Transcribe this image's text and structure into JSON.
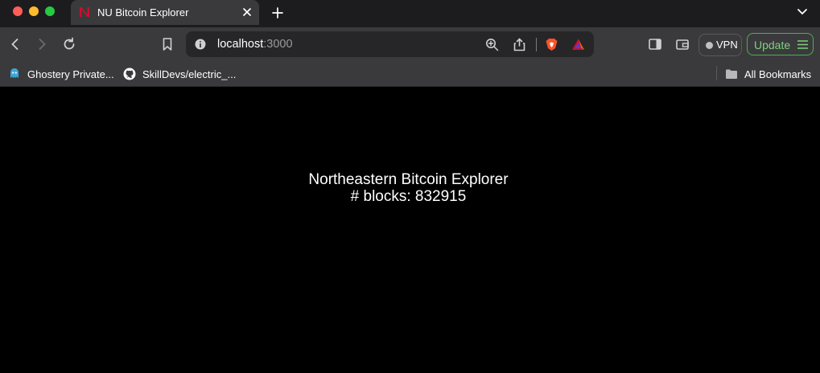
{
  "browser": {
    "tab": {
      "title": "NU Bitcoin Explorer",
      "favicon": "N-logo-icon"
    },
    "address_bar": {
      "host": "localhost",
      "port": ":3000"
    },
    "toolbar": {
      "vpn_label": "VPN",
      "update_label": "Update"
    },
    "bookmarks": [
      {
        "label": "Ghostery Private...",
        "icon": "ghostery-icon"
      },
      {
        "label": "SkillDevs/electric_...",
        "icon": "github-icon"
      }
    ],
    "all_bookmarks_label": "All Bookmarks"
  },
  "page": {
    "title": "Northeastern Bitcoin Explorer",
    "block_count": "# blocks: 832915"
  },
  "colors": {
    "tab_bar": "#1c1c1e",
    "toolbar": "#3a3a3c",
    "page_background": "#000000",
    "update_accent": "#4caf50",
    "favicon_red": "#c8102e"
  }
}
